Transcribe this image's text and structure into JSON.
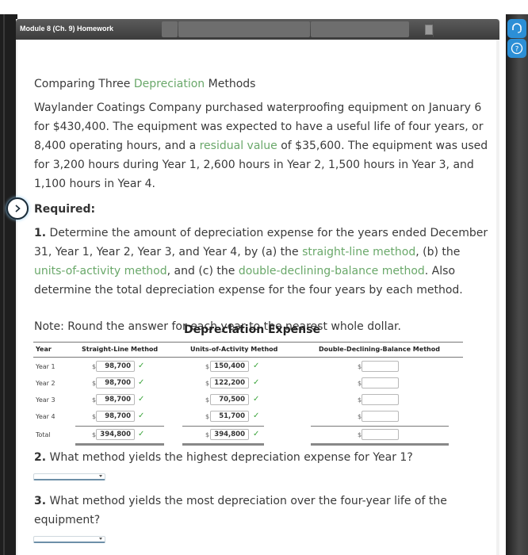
{
  "window": {
    "title": "Module 8 (Ch. 9) Homework"
  },
  "rail": {
    "support_icon": "headset-icon",
    "help_icon": "question-circle-icon"
  },
  "problem": {
    "heading_pre": "Comparing Three ",
    "heading_link": "Depreciation",
    "heading_post": " Methods",
    "para_1": "Waylander Coatings Company purchased waterproofing equipment on January 6 for $430,400. The equipment was expected to have a useful life of four years, or 8,400 operating hours, and a ",
    "para_link": "residual value",
    "para_2": " of $35,600. The equipment was used for 3,200 hours during Year 1, 2,600 hours in Year 2, 1,500 hours in Year 3, and 1,100 hours in Year 4.",
    "required_label": "Required:",
    "q1_number": "1.",
    "q1_a": " Determine the amount of depreciation expense for the years ended December 31, Year 1, Year 2, Year 3, and Year 4, by (a) the ",
    "q1_link1": "straight-line method",
    "q1_b": ", (b) the ",
    "q1_link2": "units-of-activity method",
    "q1_c": ", and (c) the ",
    "q1_link3": "double-declining-balance method",
    "q1_d": ". Also determine the total depreciation expense for the four years by each method.",
    "note": "Note: Round the answer for each year to the nearest whole dollar."
  },
  "table": {
    "title": "Depreciation Expense",
    "headers": [
      "Year",
      "Straight-Line Method",
      "Units-of-Activity Method",
      "Double-Declining-Balance Method"
    ],
    "currency": "$",
    "rows": [
      {
        "label": "Year 1",
        "straight_line": "98,700",
        "units_of_activity": "150,400",
        "ddb": ""
      },
      {
        "label": "Year 2",
        "straight_line": "98,700",
        "units_of_activity": "122,200",
        "ddb": ""
      },
      {
        "label": "Year 3",
        "straight_line": "98,700",
        "units_of_activity": "70,500",
        "ddb": ""
      },
      {
        "label": "Year 4",
        "straight_line": "98,700",
        "units_of_activity": "51,700",
        "ddb": ""
      },
      {
        "label": "Total",
        "straight_line": "394,800",
        "units_of_activity": "394,800",
        "ddb": ""
      }
    ],
    "check_glyph": "✓"
  },
  "questions": {
    "q2_number": "2.",
    "q2_text": " What method yields the highest depreciation expense for Year 1?",
    "q2_selected": "",
    "q3_number": "3.",
    "q3_text": " What method yields the most depreciation over the four-year life of the equipment?",
    "q3_selected": ""
  },
  "colors": {
    "link_green": "#6aa86a",
    "check_green": "#3da53d",
    "rail_button_blue": "#2c8fd6"
  }
}
